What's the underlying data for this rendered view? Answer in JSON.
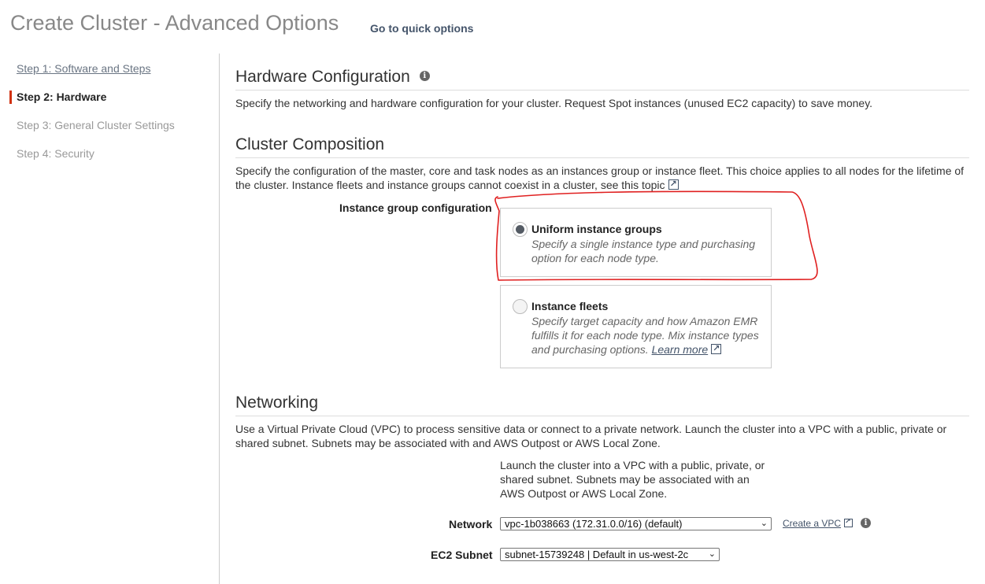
{
  "header": {
    "title": "Create Cluster - Advanced Options",
    "quick_link": "Go to quick options"
  },
  "sidebar": {
    "steps": [
      {
        "label": "Step 1: Software and Steps",
        "state": "link"
      },
      {
        "label": "Step 2: Hardware",
        "state": "active"
      },
      {
        "label": "Step 3: General Cluster Settings",
        "state": "disabled"
      },
      {
        "label": "Step 4: Security",
        "state": "disabled"
      }
    ]
  },
  "hardware": {
    "title": "Hardware Configuration",
    "description": "Specify the networking and hardware configuration for your cluster. Request Spot instances (unused EC2 capacity) to save money."
  },
  "composition": {
    "title": "Cluster Composition",
    "description": "Specify the configuration of the master, core and task nodes as an instances group or instance fleet. This choice applies to all nodes for the lifetime of the cluster. Instance fleets and instance groups cannot coexist in a cluster,",
    "see_topic": "see this topic",
    "group_label": "Instance group configuration",
    "options": [
      {
        "title": "Uniform instance groups",
        "description": "Specify a single instance type and purchasing option for each node type.",
        "selected": true
      },
      {
        "title": "Instance fleets",
        "description": "Specify target capacity and how Amazon EMR fulfills it for each node type. Mix instance types and purchasing options.",
        "link": "Learn more",
        "selected": false
      }
    ]
  },
  "networking": {
    "title": "Networking",
    "description": "Use a Virtual Private Cloud (VPC) to process sensitive data or connect to a private network. Launch the cluster into a VPC with a public, private or shared subnet. Subnets may be associated with and AWS Outpost or AWS Local Zone.",
    "vpc_note": "Launch the cluster into a VPC with a public, private, or shared subnet. Subnets may be associated with an AWS Outpost or AWS Local Zone.",
    "network_label": "Network",
    "network_value": "vpc-1b038663 (172.31.0.0/16) (default)",
    "create_vpc": "Create a VPC",
    "subnet_label": "EC2 Subnet",
    "subnet_value": "subnet-15739248 | Default in us-west-2c"
  },
  "colors": {
    "accent_red": "#d13212",
    "annotation_red": "#e02020",
    "link": "#44546a"
  }
}
